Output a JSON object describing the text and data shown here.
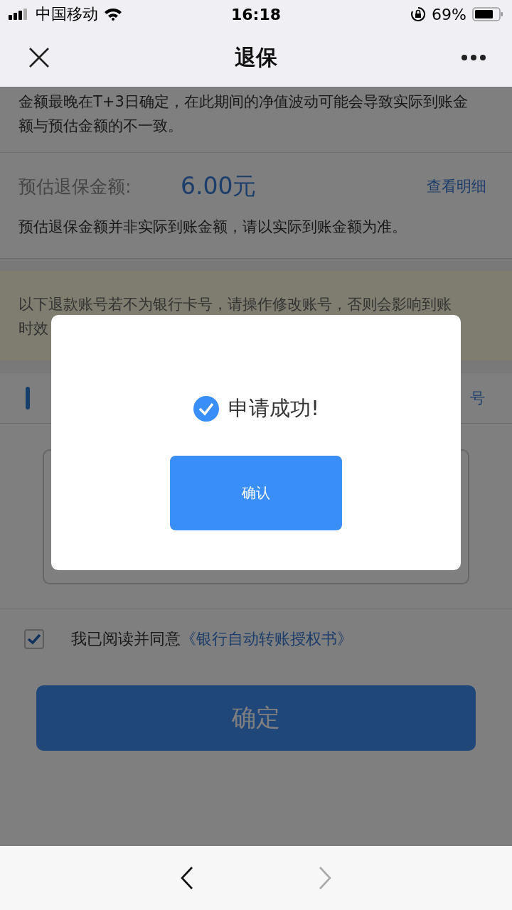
{
  "status_bar": {
    "carrier": "中国移动",
    "time": "16:18",
    "battery_percent": "69%"
  },
  "nav": {
    "title": "退保"
  },
  "info": {
    "text": "金额最晚在T+3日确定，在此期间的净值波动可能会导致实际到账金额与预估金额的不一致。"
  },
  "estimate": {
    "label": "预估退保金额:",
    "amount": "6.00元",
    "detail_link": "查看明细",
    "note": "预估退保金额并非实际到账金额，请以实际到账金额为准。"
  },
  "notice": {
    "lines": [
      "以下退款账号若不为银行卡号，请操作修改账号，否则会影响到账",
      "时效"
    ]
  },
  "account_section": {
    "link": "号"
  },
  "agreement": {
    "checked": true,
    "text": "我已阅读并同意",
    "link": "《银行自动转账授权书》"
  },
  "submit_button": "确定",
  "dialog": {
    "message": "申请成功!",
    "confirm": "确认"
  }
}
